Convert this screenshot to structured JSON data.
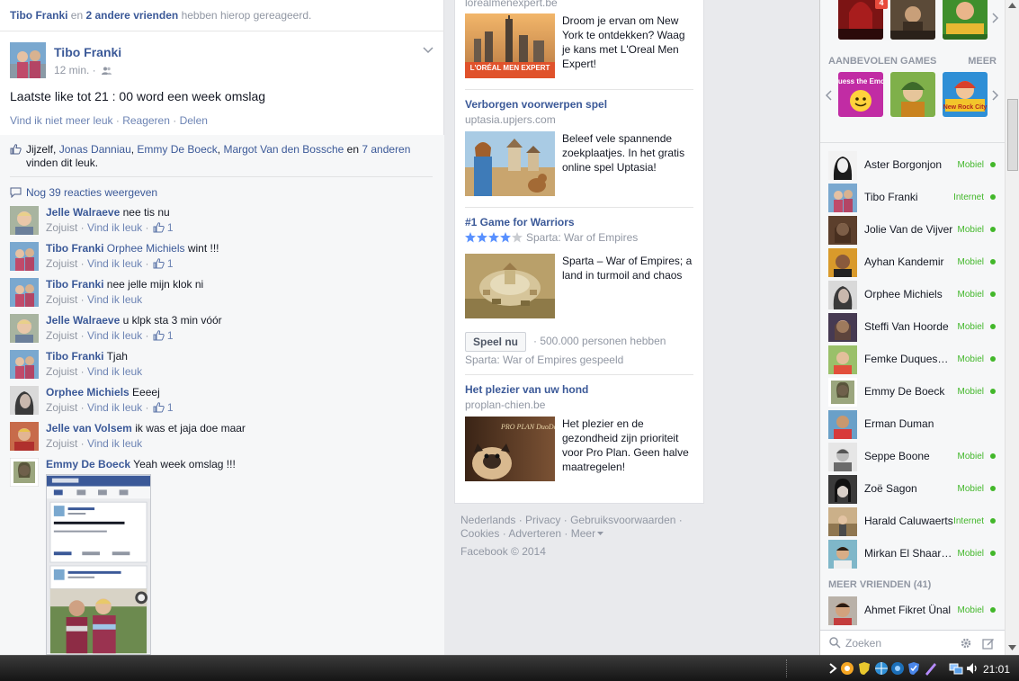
{
  "post": {
    "notice": {
      "actor": "Tibo Franki",
      "middle": "en",
      "others": "2 andere vrienden",
      "suffix": "hebben hierop gereageerd."
    },
    "author": "Tibo Franki",
    "time": "12 min. ·",
    "text": "Laatste like tot 21 : 00 word een week omslag",
    "actions": {
      "like": "Vind ik niet meer leuk",
      "dot1": " · ",
      "comment": "Reageren",
      "dot2": " · ",
      "share": "Delen"
    },
    "likes": {
      "self": "Jijzelf,",
      "names": [
        "Jonas Danniau",
        "Emmy De Boeck",
        "Margot Van den Bossche"
      ],
      "and": "en",
      "others": "7 anderen",
      "suffix": "vinden dit leuk."
    },
    "more_comments": "Nog 39 reacties weergeven",
    "comments": [
      {
        "name": "Jelle Walraeve",
        "text": "nee tis nu",
        "time": "Zojuist",
        "like": "Vind ik leuk",
        "count": "1"
      },
      {
        "name": "Tibo Franki",
        "tag": "Orphee Michiels",
        "text": "wint !!!",
        "time": "Zojuist",
        "like": "Vind ik leuk",
        "count": "1"
      },
      {
        "name": "Tibo Franki",
        "text": "nee jelle mijn klok ni",
        "time": "Zojuist",
        "like": "Vind ik leuk",
        "count": ""
      },
      {
        "name": "Jelle Walraeve",
        "text": "u klpk sta 3 min vóór",
        "time": "Zojuist",
        "like": "Vind ik leuk",
        "count": "1"
      },
      {
        "name": "Tibo Franki",
        "text": "Tjah",
        "time": "Zojuist",
        "like": "Vind ik leuk",
        "count": ""
      },
      {
        "name": "Orphee Michiels",
        "text": "Eeeej",
        "time": "Zojuist",
        "like": "Vind ik leuk",
        "count": "1"
      },
      {
        "name": "Jelle van Volsem",
        "text": "ik was et jaja doe maar",
        "time": "Zojuist",
        "like": "Vind ik leuk",
        "count": ""
      },
      {
        "name": "Emmy De Boeck",
        "text": "Yeah week omslag !!!"
      }
    ]
  },
  "ads": [
    {
      "title": "",
      "domain": "lorealmenexpert.be",
      "desc": "Droom je ervan om New York te ontdekken? Waag je kans met L'Oreal Men Expert!",
      "img_label": "L'ORÉAL MEN EXPERT"
    },
    {
      "title": "Verborgen voorwerpen spel",
      "domain": "uptasia.upjers.com",
      "desc": "Beleef vele spannende zoekplaatjes. In het gratis online spel Uptasia!"
    },
    {
      "title": "#1 Game for Warriors",
      "domain": "Sparta: War of Empires",
      "rating": 4,
      "desc": "Sparta – War of Empires; a land in turmoil and chaos",
      "play": "Speel nu",
      "played_count": "· 500.000 personen hebben",
      "played_suffix": "Sparta: War of Empires gespeeld"
    },
    {
      "title": "Het plezier van uw hond",
      "domain": "proplan-chien.be",
      "desc": "Het plezier en de gezondheid zijn prioriteit voor Pro Plan. Geen halve maatregelen!",
      "img_label": "PRO PLAN DuoDelice"
    }
  ],
  "footer": {
    "links": [
      "Nederlands",
      "Privacy",
      "Gebruiksvoorwaarden",
      "Cookies",
      "Adverteren",
      "Meer"
    ],
    "copyright": "Facebook © 2014"
  },
  "sidebar": {
    "games_badge": "4",
    "recommended_title": "AANBEVOLEN GAMES",
    "recommended_more": "MEER",
    "games": [
      "Guess the Emoji",
      "Castle game",
      "New Rock City"
    ],
    "friends": [
      {
        "name": "Aster Borgonjon",
        "status": "Mobiel"
      },
      {
        "name": "Tibo Franki",
        "status": "Internet"
      },
      {
        "name": "Jolie Van de Vijver",
        "status": "Mobiel"
      },
      {
        "name": "Ayhan Kandemir",
        "status": "Mobiel"
      },
      {
        "name": "Orphee Michiels",
        "status": "Mobiel"
      },
      {
        "name": "Steffi Van Hoorde",
        "status": "Mobiel"
      },
      {
        "name": "Femke Duquesnoy",
        "status": "Mobiel"
      },
      {
        "name": "Emmy De Boeck",
        "status": "Mobiel"
      },
      {
        "name": "Erman Duman",
        "status": ""
      },
      {
        "name": "Seppe Boone",
        "status": "Mobiel"
      },
      {
        "name": "Zoë Sagon",
        "status": "Mobiel"
      },
      {
        "name": "Harald Caluwaerts",
        "status": "Internet"
      },
      {
        "name": "Mirkan El Shaarawy",
        "status": "Mobiel"
      }
    ],
    "more_friends": "MEER VRIENDEN (41)",
    "more_friends_list": [
      {
        "name": "Ahmet Fikret Ünal",
        "status": "Mobiel"
      }
    ],
    "search_placeholder": "Zoeken"
  },
  "taskbar": {
    "clock": "21:01"
  },
  "colors": {
    "fb_blue": "#3b5998",
    "online_green": "#42b72a",
    "muted": "#9197a3"
  }
}
